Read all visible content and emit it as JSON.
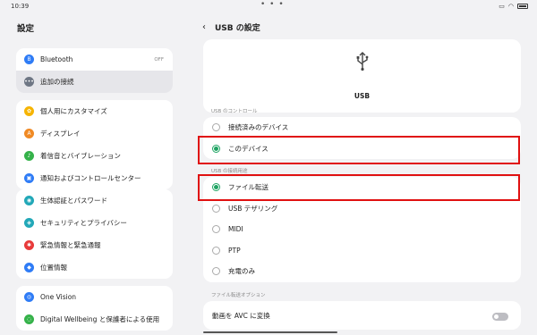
{
  "status": {
    "time": "10:39",
    "dots": "• • •"
  },
  "sidebar": {
    "title": "設定",
    "groups": [
      [
        {
          "label": "Bluetooth",
          "icon": "bluetooth-icon",
          "color": "#2f7cf6",
          "glyph": "B",
          "right": "OFF"
        },
        {
          "label": "追加の接続",
          "icon": "more-connections-icon",
          "color": "#6e7684",
          "glyph": "•••",
          "selected": true
        }
      ],
      [
        {
          "label": "個人用にカスタマイズ",
          "icon": "customize-icon",
          "color": "#f6b400",
          "glyph": "✿"
        },
        {
          "label": "ディスプレイ",
          "icon": "display-icon",
          "color": "#f08a24",
          "glyph": "A"
        },
        {
          "label": "着信音とバイブレーション",
          "icon": "sound-icon",
          "color": "#35b24a",
          "glyph": "♪"
        },
        {
          "label": "通知およびコントロールセンター",
          "icon": "notification-icon",
          "color": "#2f7cf6",
          "glyph": "▣"
        }
      ],
      [
        {
          "label": "生体認証とパスワード",
          "icon": "biometric-icon",
          "color": "#22a8b8",
          "glyph": "◉"
        },
        {
          "label": "セキュリティとプライバシー",
          "icon": "security-icon",
          "color": "#22a8b8",
          "glyph": "◈"
        },
        {
          "label": "緊急情報と緊急通報",
          "icon": "emergency-icon",
          "color": "#e83a3a",
          "glyph": "✱"
        },
        {
          "label": "位置情報",
          "icon": "location-icon",
          "color": "#2f7cf6",
          "glyph": "◆"
        }
      ],
      [
        {
          "label": "One Vision",
          "icon": "one-vision-icon",
          "color": "#2f7cf6",
          "glyph": "◎"
        },
        {
          "label": "Digital Wellbeing と保護者による使用",
          "icon": "wellbeing-icon",
          "color": "#35b24a",
          "glyph": "◌"
        }
      ]
    ]
  },
  "main": {
    "title": "USB の設定",
    "usb_label": "USB",
    "control_section": "USB のコントロール",
    "control_options": [
      {
        "label": "接続済みのデバイス",
        "checked": false
      },
      {
        "label": "このデバイス",
        "checked": true
      }
    ],
    "usage_section": "USB の接続用途",
    "usage_options": [
      {
        "label": "ファイル転送",
        "checked": true
      },
      {
        "label": "USB テザリング",
        "checked": false
      },
      {
        "label": "MIDI",
        "checked": false
      },
      {
        "label": "PTP",
        "checked": false
      },
      {
        "label": "充電のみ",
        "checked": false
      }
    ],
    "transfer_section": "ファイル転送オプション",
    "avc_label": "動画を AVC に変換",
    "avc_enabled": false
  },
  "colors": {
    "accent": "#1fa463",
    "highlight": "#e01010"
  }
}
